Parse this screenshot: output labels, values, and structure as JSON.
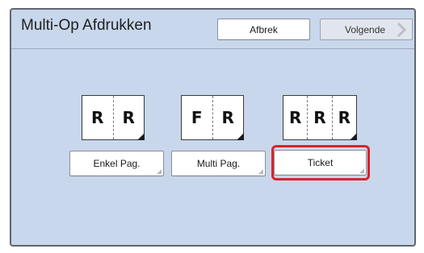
{
  "header": {
    "title": "Multi-Op Afdrukken",
    "cancel_label": "Afbrek",
    "next_label": "Volgende"
  },
  "options": [
    {
      "label": "Enkel Pag.",
      "pages": [
        "R",
        "R"
      ]
    },
    {
      "label": "Multi Pag.",
      "pages": [
        "F",
        "R"
      ]
    },
    {
      "label": "Ticket",
      "pages": [
        "R",
        "R",
        "R"
      ],
      "selected": true
    }
  ],
  "colors": {
    "selection": "#d9232a",
    "panel": "#c9d7ec"
  }
}
